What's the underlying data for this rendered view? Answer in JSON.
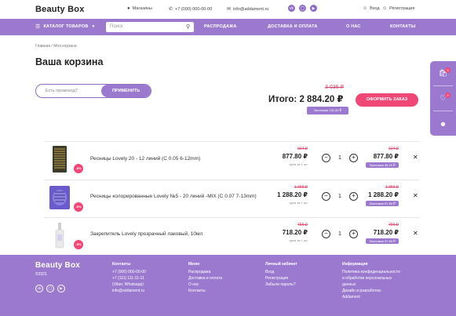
{
  "header": {
    "logo": "Beauty Box",
    "stores": "Магазины",
    "phone": "+7 (000) 000-00-00",
    "email": "info@addament.ru",
    "login": "Вход",
    "register": "Регистрация"
  },
  "nav": {
    "catalog": "КАТАЛОГ ТОВАРОВ",
    "search_placeholder": "Поиск",
    "links": [
      "РАСПРОДАЖА",
      "ДОСТАВКА И ОПЛАТА",
      "О НАС",
      "КОНТАКТЫ"
    ]
  },
  "breadcrumb": {
    "home": "Главная",
    "sep": "/",
    "current": "Моя корзина"
  },
  "page_title": "Ваша корзина",
  "promo": {
    "placeholder": "Есть промокод?",
    "apply": "ПРИМЕНИТЬ"
  },
  "summary": {
    "old_total": "3 036 ₽",
    "total_label": "Итого:",
    "total": "2 884.20 ₽",
    "savings": "Экономия 151.80 ₽",
    "checkout": "ОФОРМИТЬ ЗАКАЗ"
  },
  "cart_badge": "3",
  "wish_badge": "0",
  "items": [
    {
      "name": "Ресницы Lovely 20 - 12 линий (C 0.05 6-12mm)",
      "discount": "-5%",
      "old_price": "924 ₽",
      "price": "877.80 ₽",
      "unit": "цена за 1 шт",
      "qty": "1",
      "old_sum": "924 ₽",
      "sum": "877.80 ₽",
      "economy": "Экономия 46.20 ₽"
    },
    {
      "name": "Ресницы колорированные Lovely №5 - 20 линий -MIX (C 0.07 7-13mm)",
      "discount": "-5%",
      "old_price": "1 356 ₽",
      "price": "1 288.20 ₽",
      "unit": "цена за 1 шт",
      "qty": "1",
      "old_sum": "1 356 ₽",
      "sum": "1 288.20 ₽",
      "economy": "Экономия 67.80 ₽"
    },
    {
      "name": "Закрепитель Lovely прозрачный лаковый, 10мл",
      "discount": "-5%",
      "old_price": "756 ₽",
      "price": "718.20 ₽",
      "unit": "цена за 1 шт",
      "qty": "1",
      "old_sum": "756 ₽",
      "sum": "718.20 ₽",
      "economy": "Экономия 37.80 ₽"
    }
  ],
  "footer": {
    "logo": "Beauty Box",
    "year": "©2021",
    "contacts_title": "Контакты",
    "contacts": [
      "+7 (000) 000-00-00",
      "+7 (111) 111-11-11",
      "(Viber, Whatsapp)",
      "info@addament.ru"
    ],
    "menu_title": "Меню",
    "menu": [
      "Распродажа",
      "Доставка и оплата",
      "О нас",
      "Контакты"
    ],
    "account_title": "Личный кабинет",
    "account": [
      "Вход",
      "Регистрация",
      "Забыли пароль?"
    ],
    "info_title": "Информация",
    "info": [
      "Политика конфиденциальности",
      "и обработки персональных",
      "данных",
      "Дизайн и разработка:",
      "Addament"
    ]
  }
}
